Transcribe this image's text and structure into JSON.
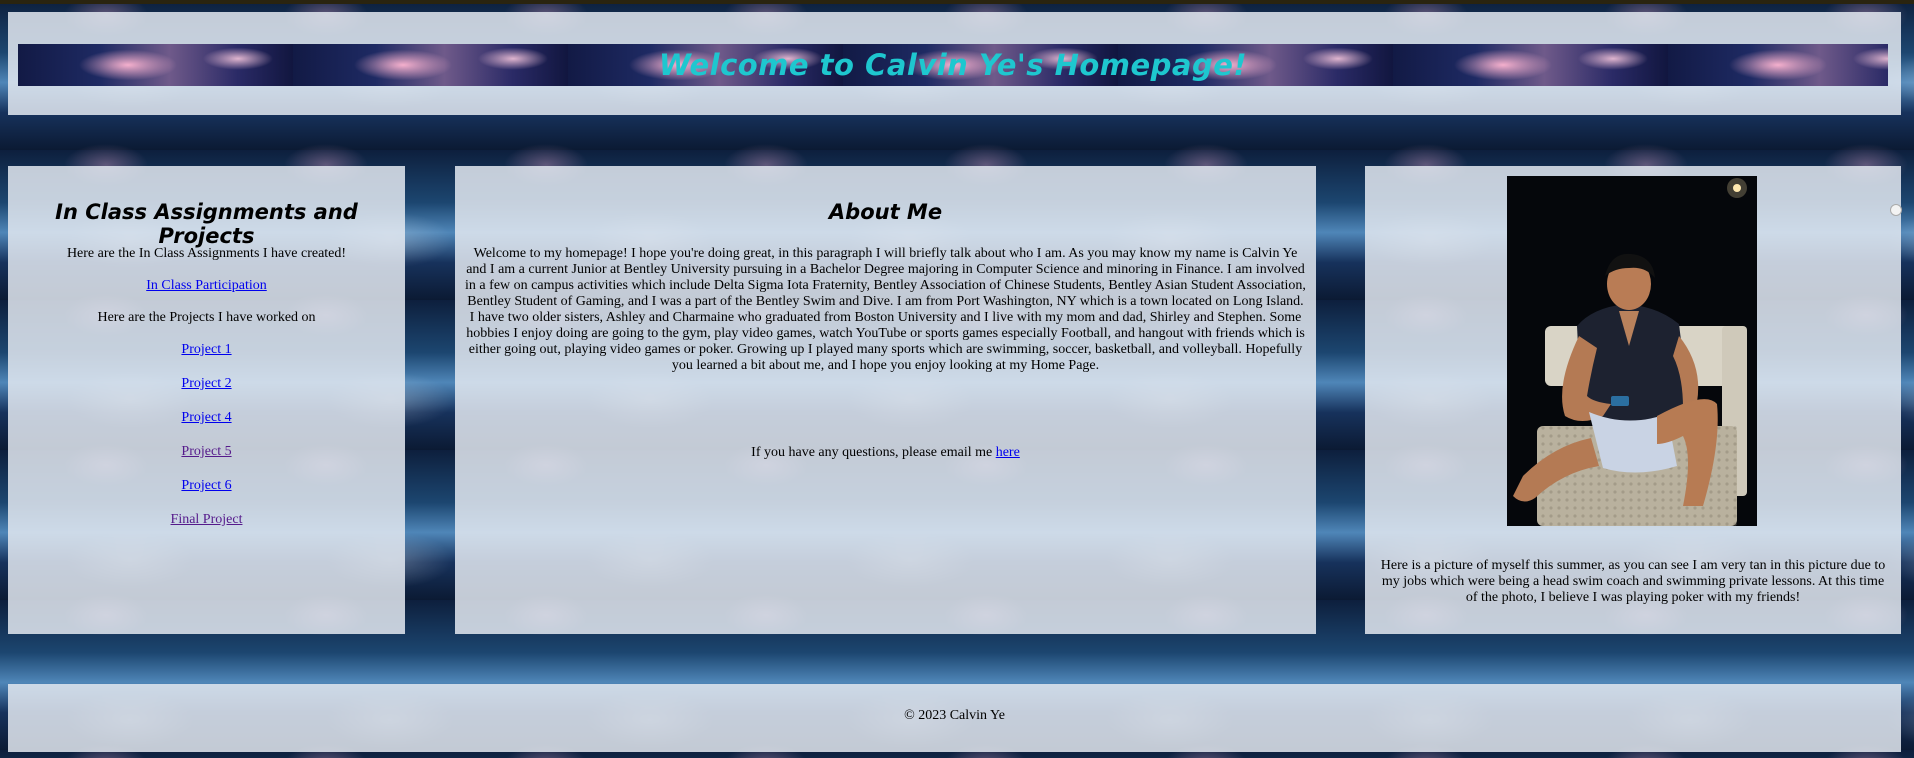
{
  "header": {
    "title": "Welcome to Calvin Ye's Homepage!"
  },
  "left_panel": {
    "title": "In Class Assignments and Projects",
    "assignments_intro": "Here are the In Class Assignments I have created!",
    "participation_link": "In Class Participation",
    "projects_intro": "Here are the Projects I have worked on",
    "project_links": [
      "Project 1",
      "Project 2",
      "Project 4",
      "Project 5",
      "Project 6",
      "Final Project"
    ]
  },
  "about": {
    "title": "About Me",
    "paragraph": "Welcome to my homepage! I hope you're doing great, in this paragraph I will briefly talk about who I am. As you may know my name is Calvin Ye and I am a current Junior at Bentley University pursuing in a Bachelor Degree majoring in Computer Science and minoring in Finance. I am involved in a few on campus activities which include Delta Sigma Iota Fraternity, Bentley Association of Chinese Students, Bentley Asian Student Association, Bentley Student of Gaming, and I was a part of the Bentley Swim and Dive. I am from Port Washington, NY which is a town located on Long Island. I have two older sisters, Ashley and Charmaine who graduated from Boston University and I live with my mom and dad, Shirley and Stephen. Some hobbies I enjoy doing are going to the gym, play video games, watch YouTube or sports games especially Football, and hangout with friends which is either going out, playing video games or poker. Growing up I played many sports which are swimming, soccer, basketball, and volleyball. Hopefully you learned a bit about me, and I hope you enjoy looking at my Home Page.",
    "email_prefix": "If you have any questions, please email me ",
    "email_link": "here"
  },
  "photo_panel": {
    "caption": "Here is a picture of myself this summer, as you can see I am very tan in this picture due to my jobs which were being a head swim coach and swimming private lessons. At this time of the photo, I believe I was playing poker with my friends!"
  },
  "footer": {
    "copyright": "© 2023 Calvin Ye"
  },
  "colors": {
    "title_teal": "#1ec7cf",
    "link_blue": "#0000ee",
    "link_visited": "#551a8b",
    "panel_bg": "#e2e8f0"
  }
}
